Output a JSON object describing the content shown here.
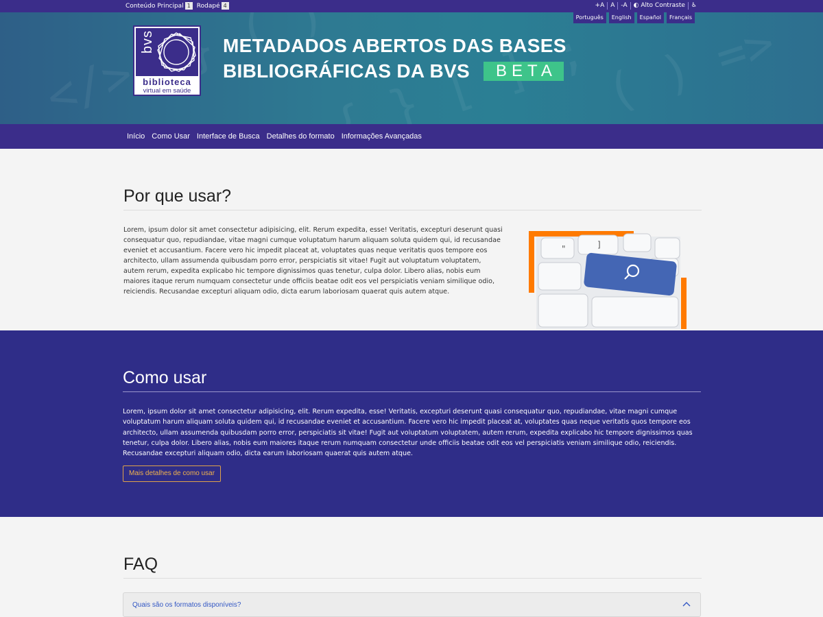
{
  "topbar": {
    "skip_main": "Conteúdo Principal",
    "skip_main_key": "1",
    "skip_footer": "Rodapé",
    "skip_footer_key": "4",
    "font_plus": "+A",
    "font_normal": "A",
    "font_minus": "-A",
    "contrast": "Alto Contraste"
  },
  "languages": [
    "Português",
    "English",
    "Español",
    "Français"
  ],
  "logo": {
    "short": "bvs",
    "line1": "biblioteca",
    "line2": "virtual em saúde"
  },
  "header": {
    "title_line1": "METADADOS ABERTOS DAS BASES",
    "title_line2": "BIBLIOGRÁFICAS DA BVS",
    "badge": "BETA"
  },
  "nav": [
    "Início",
    "Como Usar",
    "Interface de Busca",
    "Detalhes do formato",
    "Informações Avançadas"
  ],
  "why": {
    "title": "Por que usar?",
    "text": "Lorem, ipsum dolor sit amet consectetur adipisicing, elit. Rerum expedita, esse! Veritatis, excepturi deserunt quasi consequatur quo, repudiandae, vitae magni cumque voluptatum harum aliquam soluta quidem qui, id recusandae eveniet et accusantium. Facere vero hic impedit placeat at, voluptates quas neque veritatis quos tempore eos architecto, ullam assumenda quibusdam porro error, perspiciatis sit vitae! Fugit aut voluptatum voluptatem, autem rerum, expedita explicabo hic tempore dignissimos quas tenetur, culpa dolor. Libero alias, nobis eum maiores itaque rerum numquam consectetur unde officiis beatae odit eos vel perspiciatis veniam similique odio, reiciendis. Recusandae excepturi aliquam odio, dicta earum laboriosam quaerat quis autem atque."
  },
  "how": {
    "title": "Como usar",
    "text": "Lorem, ipsum dolor sit amet consectetur adipisicing, elit. Rerum expedita, esse! Veritatis, excepturi deserunt quasi consequatur quo, repudiandae, vitae magni cumque voluptatum harum aliquam soluta quidem qui, id recusandae eveniet et accusantium. Facere vero hic impedit placeat at, voluptates quas neque veritatis quos tempore eos architecto, ullam assumenda quibusdam porro error, perspiciatis sit vitae! Fugit aut voluptatum voluptatem, autem rerum, expedita explicabo hic tempore dignissimos quas tenetur, culpa dolor. Libero alias, nobis eum maiores itaque rerum numquam consectetur unde officiis beatae odit eos vel perspiciatis veniam similique odio, reiciendis. Recusandae excepturi aliquam odio, dicta earum laboriosam quaerat quis autem atque.",
    "button": "Mais detalhes de como usar"
  },
  "faq": {
    "title": "FAQ",
    "q1": "Quais são os formatos disponíveis?"
  },
  "colors": {
    "brand": "#3b2d8a",
    "section": "#2f2d88",
    "beta": "#3ec48a",
    "accent_orange": "#ff7a00",
    "link": "#3257c4"
  }
}
